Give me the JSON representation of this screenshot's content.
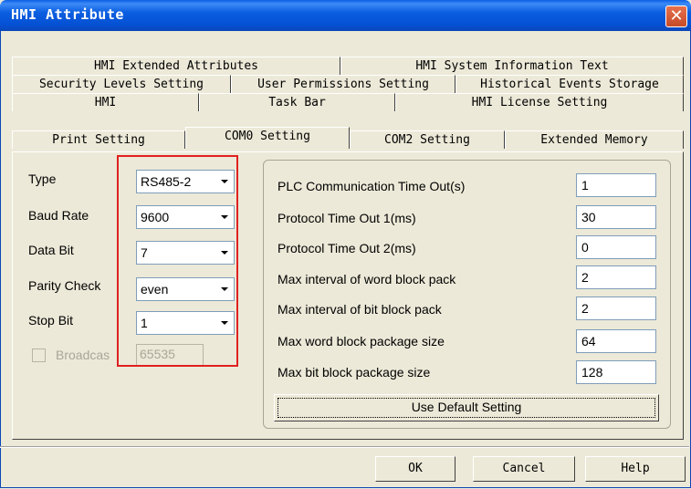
{
  "window": {
    "title": "HMI Attribute",
    "close_glyph": "✕"
  },
  "tabs": {
    "row1": [
      "HMI Extended Attributes",
      "HMI System Information Text"
    ],
    "row2": [
      "Security Levels Setting",
      "User Permissions Setting",
      "Historical Events Storage"
    ],
    "row3": [
      "HMI",
      "Task Bar",
      "HMI License Setting"
    ],
    "row4": [
      "Print Setting",
      "COM0 Setting",
      "COM2 Setting",
      "Extended Memory"
    ],
    "active": "COM0 Setting"
  },
  "left": {
    "type_label": "Type",
    "type_value": "RS485-2",
    "baud_label": "Baud Rate",
    "baud_value": "9600",
    "databit_label": "Data Bit",
    "databit_value": "7",
    "parity_label": "Parity Check",
    "parity_value": "even",
    "stopbit_label": "Stop Bit",
    "stopbit_value": "1",
    "broadcast_label": "Broadcas",
    "broadcast_value": "65535"
  },
  "right": {
    "items": [
      {
        "label": "PLC Communication Time Out(s)",
        "value": "1"
      },
      {
        "label": "Protocol Time Out 1(ms)",
        "value": "30"
      },
      {
        "label": "Protocol Time Out 2(ms)",
        "value": "0"
      },
      {
        "label": "Max interval of word block pack",
        "value": "2"
      },
      {
        "label": "Max interval of bit block pack",
        "value": "2"
      },
      {
        "label": "Max word block package size",
        "value": "64"
      },
      {
        "label": "Max bit block package size",
        "value": "128"
      }
    ],
    "use_default_label": "Use Default Setting"
  },
  "footer": {
    "ok_label": "OK",
    "cancel_label": "Cancel",
    "help_label": "Help"
  },
  "colors": {
    "titlebar": "#0a5fe4",
    "highlight": "#e02020",
    "dialog_bg": "#ece9d8"
  },
  "icons": {
    "close": "close-icon",
    "dropdown": "chevron-down-icon",
    "checkbox": "checkbox-icon"
  }
}
